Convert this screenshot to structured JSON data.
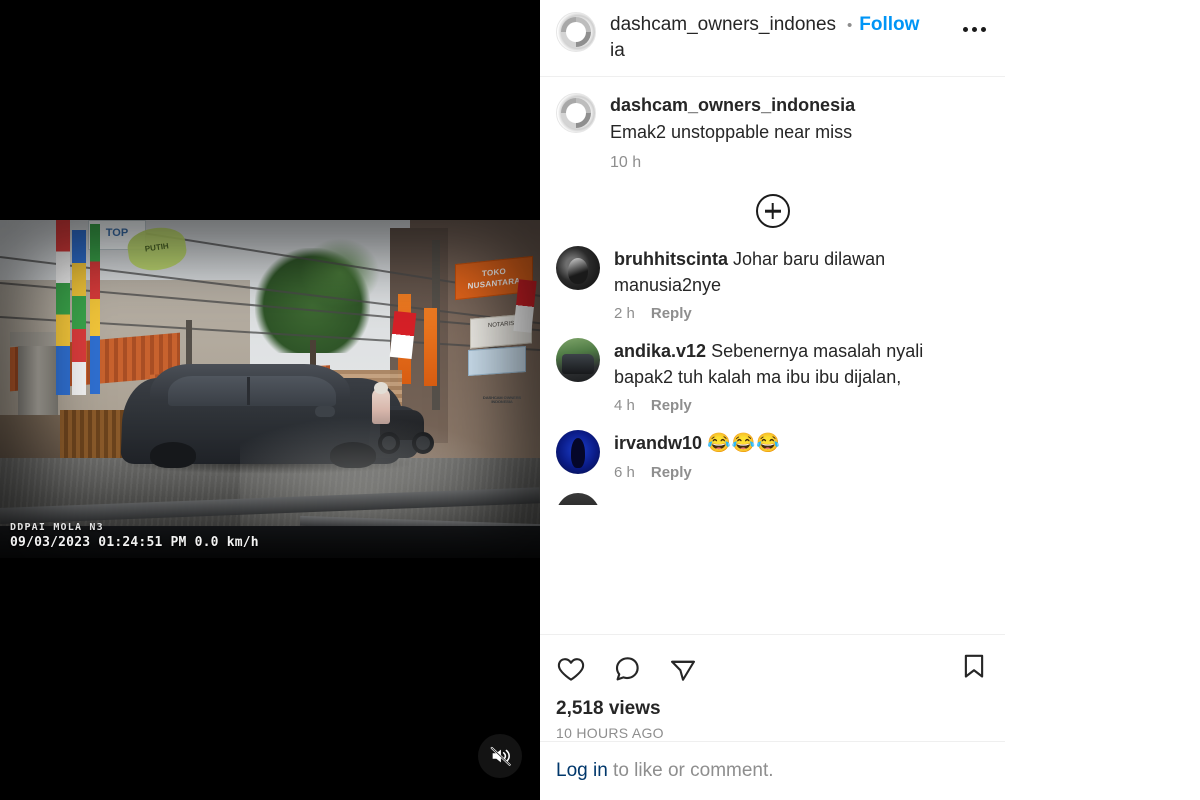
{
  "header": {
    "username": "dashcam_owners_indonesia",
    "separator": "•",
    "follow_label": "Follow",
    "more_options_label": "More options"
  },
  "caption": {
    "username": "dashcam_owners_indonesia",
    "text": "Emak2 unstoppable near miss",
    "time": "10 h"
  },
  "load_more": {
    "label": "Load more comments"
  },
  "comments": [
    {
      "username": "bruhhitscinta",
      "text": "Johar baru dilawan manusia2nye",
      "time": "2 h",
      "reply_label": "Reply"
    },
    {
      "username": "andika.v12",
      "text": "Sebenernya masalah nyali bapak2 tuh kalah ma ibu ibu dijalan,",
      "time": "4 h",
      "reply_label": "Reply"
    },
    {
      "username": "irvandw10",
      "text": "😂😂😂",
      "time": "6 h",
      "reply_label": "Reply"
    }
  ],
  "actions": {
    "like_label": "Like",
    "comment_label": "Comment",
    "share_label": "Share",
    "save_label": "Save",
    "views": "2,518 views",
    "posted_ago": "10 HOURS AGO"
  },
  "login": {
    "link_label": "Log in",
    "rest_text": " to like or comment."
  },
  "video": {
    "osd_brand": "DDPAI MOLA N3",
    "osd_stamp": "09/03/2023 01:24:51 PM 0.0 km/h",
    "mute_label": "Unmute",
    "signs": {
      "orange_sign": "TOKO NUSANTARA",
      "white_sign": "NOTARIS",
      "top_sign": "TOP",
      "green_sign": "PUTIH"
    }
  },
  "colors": {
    "accent_blue": "#0095f6",
    "link_dark_blue": "#00376b",
    "text_primary": "#262626",
    "text_secondary": "#8e8e8e"
  }
}
